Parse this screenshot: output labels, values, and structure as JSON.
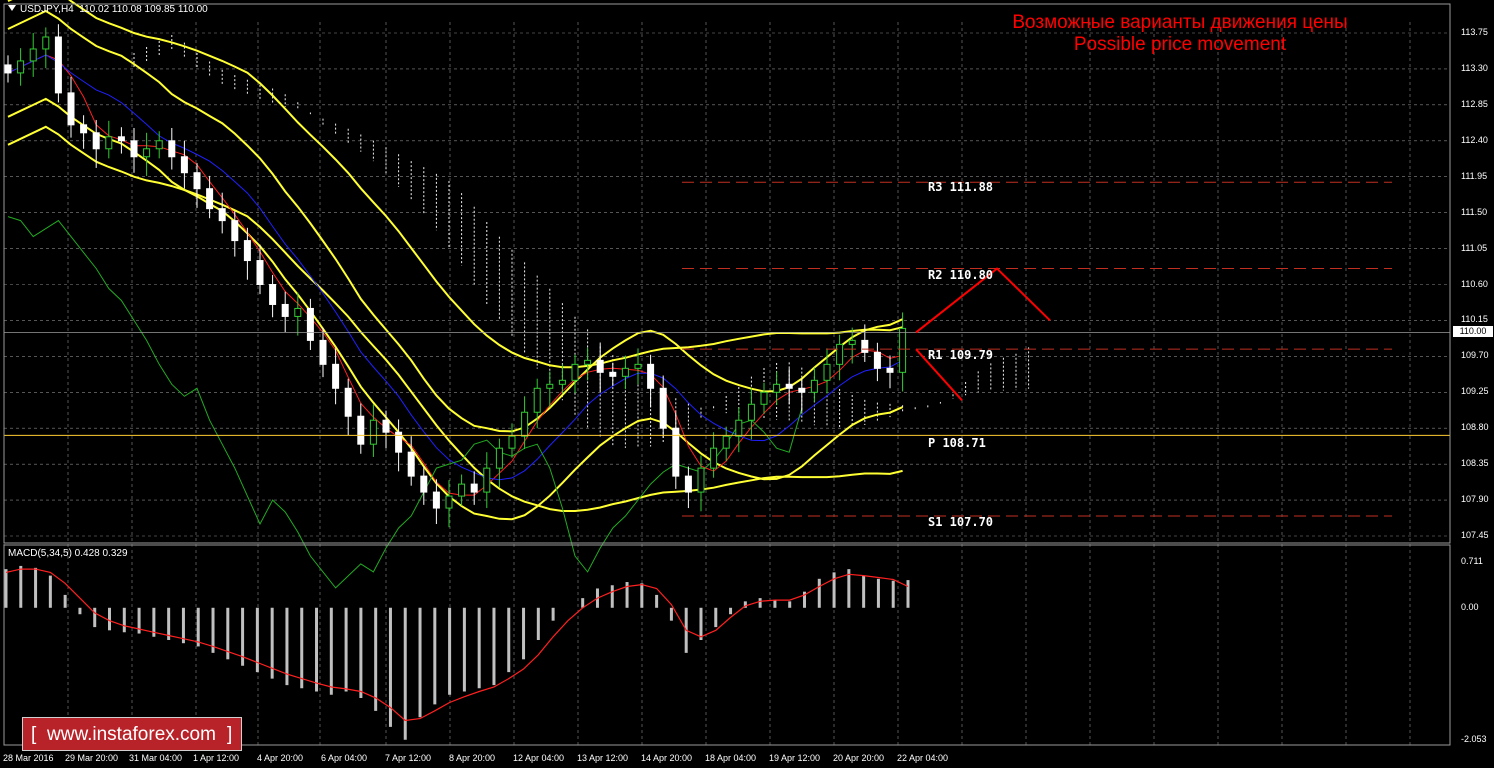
{
  "header": {
    "symbol_info": "USDJPY,H4  110.02 110.08 109.85 110.00"
  },
  "title": {
    "ru": "Возможные варианты движения цены",
    "en": "Possible price movement"
  },
  "macd": {
    "label": "MACD(5,34,5) 0.428 0.329"
  },
  "watermark": {
    "text": "www.instaforex.com",
    "left_bracket": "[",
    "right_bracket": "]"
  },
  "current_price": "110.00",
  "colors": {
    "background": "#000000",
    "grid": "#8a8a8a",
    "bull_candle": "#33cc33",
    "bear_candle": "#ffffff",
    "bollinger": "#ffff33",
    "tenkan": "#ff2020",
    "kijun": "#2020ff",
    "chikou": "#22aa22",
    "cloud": "#f0f0f0",
    "level_line": "#c03020",
    "pivot_line": "#ffcc33",
    "arrow": "#ff0000",
    "macd_hist": "#c0c0c0",
    "macd_signal": "#ff2020"
  },
  "chart_data": {
    "type": "candlestick",
    "instrument": "USDJPY",
    "timeframe": "H4",
    "y_axis_ticks": [
      "113.75",
      "113.30",
      "112.85",
      "112.40",
      "111.95",
      "111.50",
      "111.05",
      "110.60",
      "110.15",
      "109.70",
      "109.25",
      "108.80",
      "108.35",
      "107.90",
      "107.45"
    ],
    "x_axis_ticks": [
      "28 Mar 2016",
      "29 Mar 20:00",
      "31 Mar 04:00",
      "1 Apr 12:00",
      "4 Apr 20:00",
      "6 Apr 04:00",
      "7 Apr 12:00",
      "8 Apr 20:00",
      "12 Apr 04:00",
      "13 Apr 12:00",
      "14 Apr 20:00",
      "18 Apr 04:00",
      "19 Apr 12:00",
      "20 Apr 20:00",
      "22 Apr 04:00"
    ],
    "ylim": [
      107.4,
      114.0
    ],
    "levels": [
      {
        "name": "R3",
        "label": "R3 111.88",
        "value": 111.88
      },
      {
        "name": "R2",
        "label": "R2 110.80",
        "value": 110.8
      },
      {
        "name": "R1",
        "label": "R1 109.79",
        "value": 109.79
      },
      {
        "name": "P",
        "label": "P 108.71",
        "value": 108.71
      },
      {
        "name": "S1",
        "label": "S1 107.70",
        "value": 107.7
      }
    ],
    "closes": [
      113.25,
      113.4,
      113.55,
      113.7,
      113.0,
      112.6,
      112.5,
      112.3,
      112.45,
      112.4,
      112.2,
      112.3,
      112.4,
      112.2,
      112.0,
      111.8,
      111.55,
      111.4,
      111.15,
      110.9,
      110.6,
      110.35,
      110.2,
      110.3,
      109.9,
      109.6,
      109.3,
      108.95,
      108.6,
      108.9,
      108.75,
      108.5,
      108.2,
      108.0,
      107.8,
      107.95,
      108.1,
      108.0,
      108.3,
      108.55,
      108.7,
      109.0,
      109.3,
      109.35,
      109.4,
      109.6,
      109.65,
      109.5,
      109.45,
      109.55,
      109.6,
      109.3,
      108.8,
      108.2,
      108.0,
      108.3,
      108.55,
      108.7,
      108.9,
      109.1,
      109.25,
      109.35,
      109.3,
      109.25,
      109.4,
      109.6,
      109.85,
      109.9,
      109.75,
      109.55,
      109.5,
      110.05
    ],
    "macd_ylim": [
      -2.053,
      0.711
    ],
    "macd_ticks": [
      "0.711",
      "0.00",
      "-2.053"
    ],
    "macd_hist": [
      0.6,
      0.65,
      0.62,
      0.5,
      0.2,
      -0.1,
      -0.3,
      -0.35,
      -0.38,
      -0.4,
      -0.45,
      -0.5,
      -0.55,
      -0.6,
      -0.7,
      -0.8,
      -0.9,
      -1.0,
      -1.1,
      -1.2,
      -1.25,
      -1.3,
      -1.35,
      -1.3,
      -1.4,
      -1.6,
      -1.85,
      -2.05,
      -1.7,
      -1.5,
      -1.35,
      -1.3,
      -1.25,
      -1.2,
      -1.0,
      -0.8,
      -0.5,
      -0.2,
      0.0,
      0.15,
      0.3,
      0.35,
      0.4,
      0.38,
      0.2,
      -0.2,
      -0.7,
      -0.5,
      -0.3,
      -0.1,
      0.1,
      0.15,
      0.12,
      0.1,
      0.25,
      0.45,
      0.55,
      0.6,
      0.5,
      0.45,
      0.42,
      0.43
    ],
    "macd_signal": [
      0.55,
      0.6,
      0.6,
      0.55,
      0.38,
      0.15,
      -0.08,
      -0.2,
      -0.28,
      -0.33,
      -0.38,
      -0.43,
      -0.48,
      -0.53,
      -0.6,
      -0.68,
      -0.76,
      -0.85,
      -0.94,
      -1.03,
      -1.1,
      -1.17,
      -1.23,
      -1.26,
      -1.3,
      -1.4,
      -1.55,
      -1.75,
      -1.72,
      -1.6,
      -1.47,
      -1.38,
      -1.3,
      -1.23,
      -1.1,
      -0.95,
      -0.73,
      -0.45,
      -0.2,
      0.0,
      0.15,
      0.25,
      0.33,
      0.36,
      0.3,
      0.05,
      -0.35,
      -0.45,
      -0.35,
      -0.15,
      0.03,
      0.1,
      0.12,
      0.12,
      0.2,
      0.33,
      0.45,
      0.52,
      0.5,
      0.47,
      0.44,
      0.33
    ]
  }
}
